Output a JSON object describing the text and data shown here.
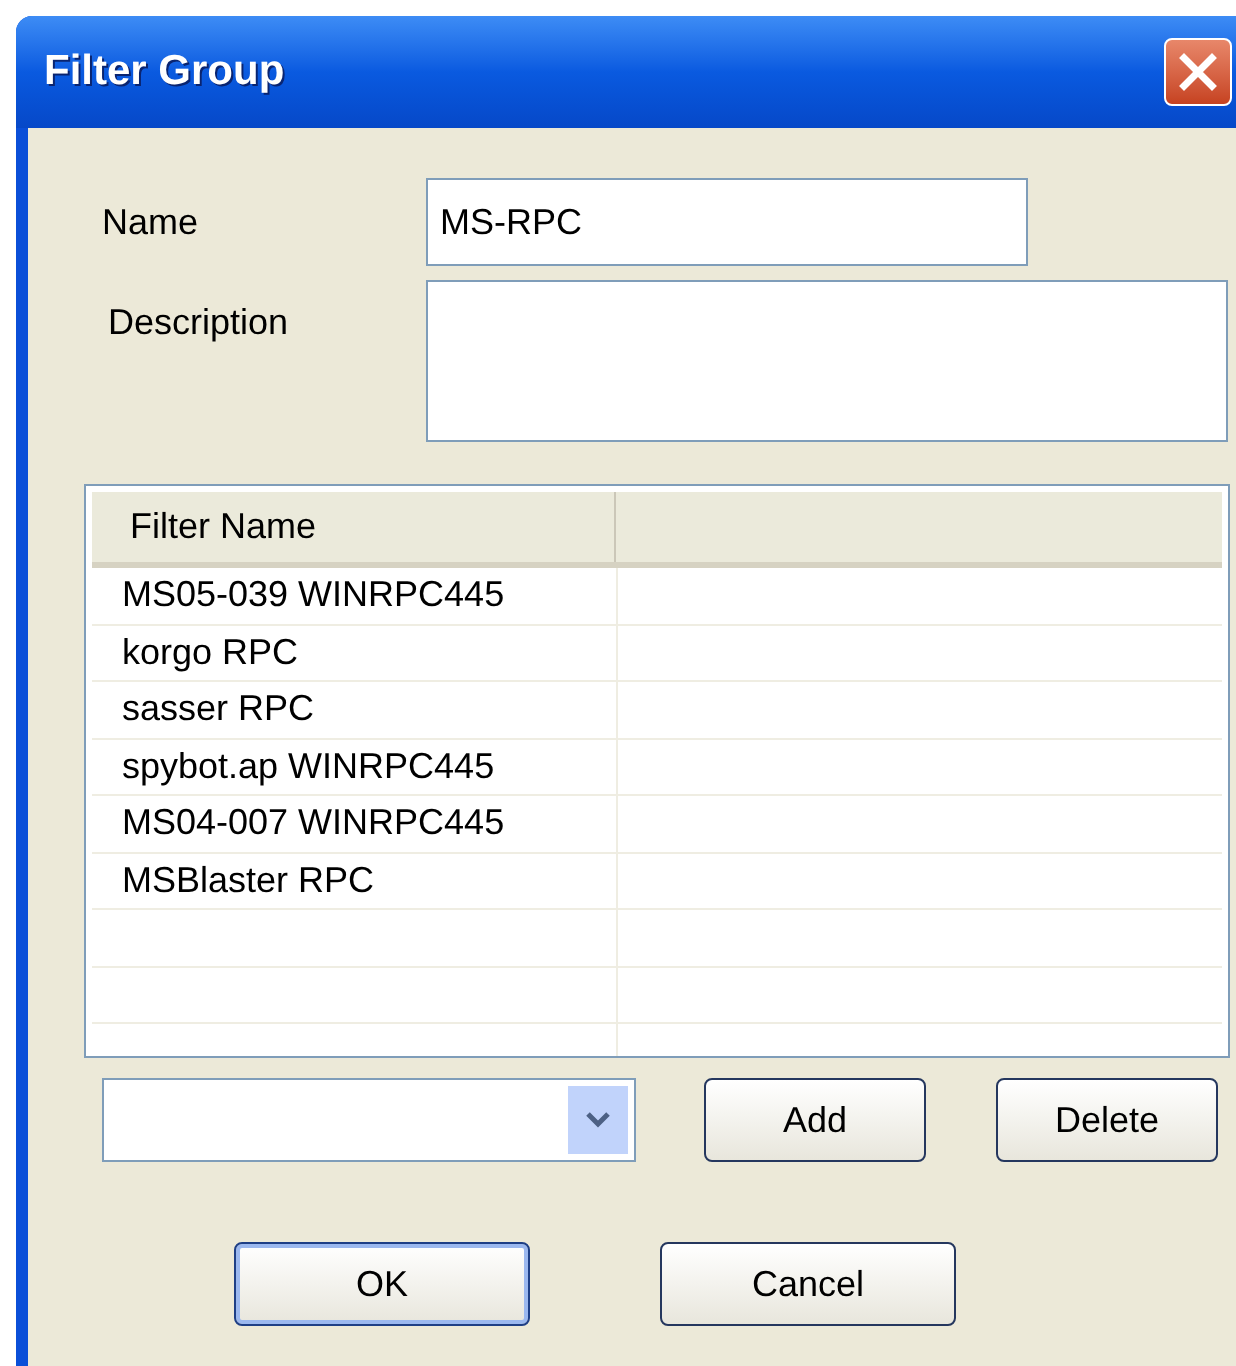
{
  "window": {
    "title": "Filter Group"
  },
  "name_field": {
    "label": "Name",
    "value": "MS-RPC"
  },
  "description_field": {
    "label": "Description"
  },
  "filter_list": {
    "columns": [
      "Filter Name"
    ],
    "rows": [
      "MS05-039 WINRPC445",
      "korgo RPC",
      "sasser RPC",
      "spybot.ap WINRPC445",
      "MS04-007 WINRPC445",
      "MSBlaster RPC"
    ]
  },
  "row_buttons": [
    {
      "label": "Add",
      "default": false
    },
    {
      "label": "Delete",
      "default": false
    }
  ],
  "dialog_buttons": [
    {
      "label": "OK",
      "default": true
    },
    {
      "label": "Cancel",
      "default": false
    }
  ]
}
